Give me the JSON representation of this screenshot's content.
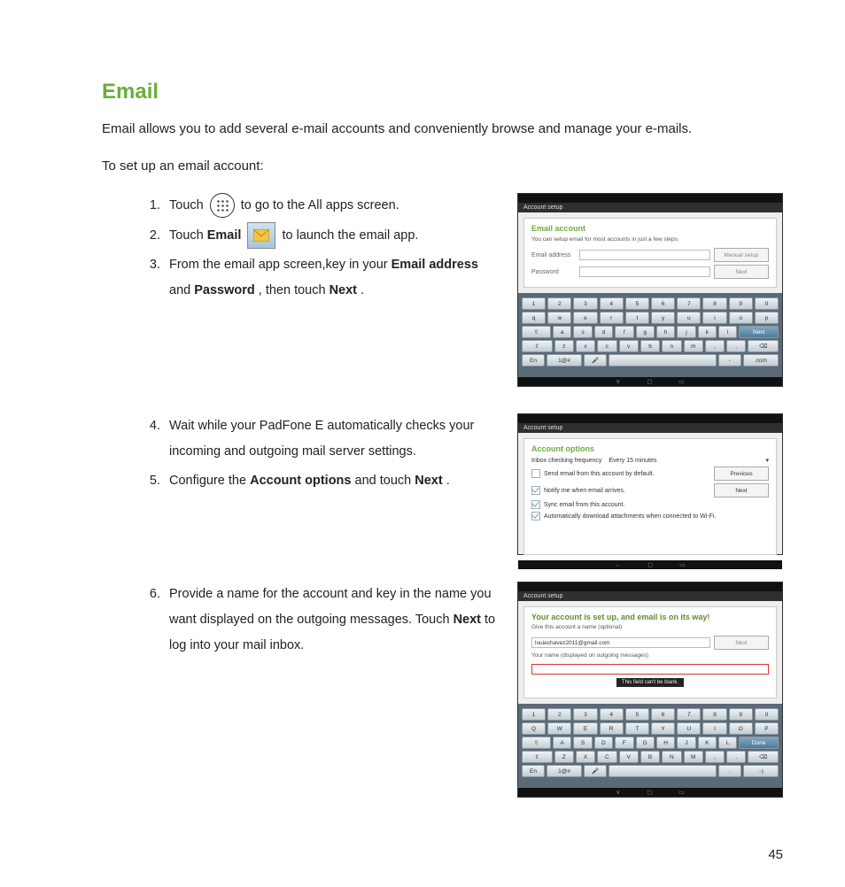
{
  "page_number": "45",
  "heading": "Email",
  "intro1": "Email allows you to add several e-mail accounts and conveniently browse and manage your e-mails.",
  "intro2": "To set up an email account:",
  "steps": {
    "s1a": "Touch ",
    "s1b": " to go to the All apps screen.",
    "s2a": "Touch ",
    "s2b": "Email",
    "s2c": " to launch the email app.",
    "s3a": "From the email app screen,key in your ",
    "s3b": "Email address",
    "s3c": " and ",
    "s3d": "Password",
    "s3e": ", then  touch ",
    "s3f": "Next",
    "s3g": ".",
    "s4": "Wait while your PadFone E automatically checks your incoming and outgoing mail server settings.",
    "s5a": "Configure the ",
    "s5b": "Account options",
    "s5c": " and touch ",
    "s5d": "Next",
    "s5e": ".",
    "s6a": "Provide a name for the account and key in the name you want displayed on the outgoing messages. Touch ",
    "s6b": "Next",
    "s6c": " to log into your mail inbox."
  },
  "shot1": {
    "titlebar": "Account setup",
    "panel_title": "Email account",
    "panel_sub": "You can setup email for most accounts in just a few steps.",
    "lbl_email": "Email address",
    "lbl_pass": "Password",
    "btn_manual": "Manual setup",
    "btn_next": "Next",
    "kb_row1": [
      "1",
      "2",
      "3",
      "4",
      "5",
      "6",
      "7",
      "8",
      "9",
      "0"
    ],
    "kb_row2": [
      "q",
      "w",
      "e",
      "r",
      "t",
      "y",
      "u",
      "i",
      "o",
      "p"
    ],
    "kb_row3": [
      "a",
      "s",
      "d",
      "f",
      "g",
      "h",
      "j",
      "k",
      "l"
    ],
    "kb_row3_end": "Next",
    "kb_row4": [
      "z",
      "x",
      "c",
      "v",
      "b",
      "n",
      "m",
      ",",
      "."
    ],
    "kb_row5_l": "En",
    "kb_row5_sym": "1@#",
    "kb_row5_com": ".com"
  },
  "shot2": {
    "titlebar": "Account setup",
    "panel_title": "Account options",
    "freq_label": "Inbox checking frequency",
    "freq_value": "Every 15 minutes",
    "chk1": "Send email from this account by default.",
    "chk2": "Notify me when email arrives.",
    "chk3": "Sync email from this account.",
    "chk4": "Automatically download attachments when connected to Wi-Fi.",
    "btn_prev": "Previous",
    "btn_next": "Next"
  },
  "shot3": {
    "titlebar": "Account setup",
    "ready": "Your account is set up, and email is on its way!",
    "sub1": "Give this account a name (optional)",
    "value1": "louiechavez2011@gmail.com",
    "sub2": "Your name (displayed on outgoing messages)",
    "btn_next": "Next",
    "popup": "This field can't be blank.",
    "kb_row1": [
      "1",
      "2",
      "3",
      "4",
      "5",
      "6",
      "7",
      "8",
      "9",
      "0"
    ],
    "kb_row2": [
      "Q",
      "W",
      "E",
      "R",
      "T",
      "Y",
      "U",
      "I",
      "O",
      "P"
    ],
    "kb_row3": [
      "A",
      "S",
      "D",
      "F",
      "G",
      "H",
      "J",
      "K",
      "L"
    ],
    "kb_row3_end": "Done",
    "kb_row4": [
      "Z",
      "X",
      "C",
      "V",
      "B",
      "N",
      "M",
      ",",
      "."
    ],
    "kb_row5_l": "En",
    "kb_row5_sym": "1@#"
  }
}
